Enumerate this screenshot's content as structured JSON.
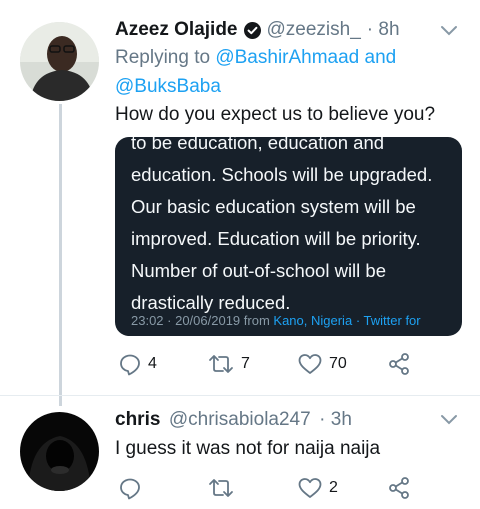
{
  "tweet1": {
    "name": "Azeez Olajide",
    "handle": "@zeezish_",
    "time": "· 8h",
    "replying_prefix": "Replying to",
    "replying_to_1": "@BashirAhmaad and",
    "replying_to_2": "@BuksBaba",
    "text": "How do you expect us to believe you?",
    "quote": {
      "lines": [
        "to be education, education and",
        "education. Schools will be upgraded.",
        "Our basic education system will be",
        "improved. Education will be priority.",
        "Number of out-of-school will be",
        "drastically reduced."
      ],
      "timestamp": "23:02 · 20/06/2019",
      "from_label": "from",
      "location": "Kano, Nigeria",
      "separator": "·",
      "source": "Twitter for"
    },
    "replies": "4",
    "retweets": "7",
    "likes": "70"
  },
  "tweet2": {
    "name": "chris",
    "handle": "@chrisabiola247",
    "time": "· 3h",
    "text": "I guess it was not for naija naija",
    "replies": "",
    "retweets": "",
    "likes": "2"
  },
  "colors": {
    "accent": "#1da1f2",
    "secondary_text": "#657786",
    "quote_bg": "#17202a",
    "icon": "#657786"
  },
  "icons": [
    "verified-icon",
    "caret-down-icon",
    "reply-icon",
    "retweet-icon",
    "like-icon",
    "share-icon"
  ]
}
